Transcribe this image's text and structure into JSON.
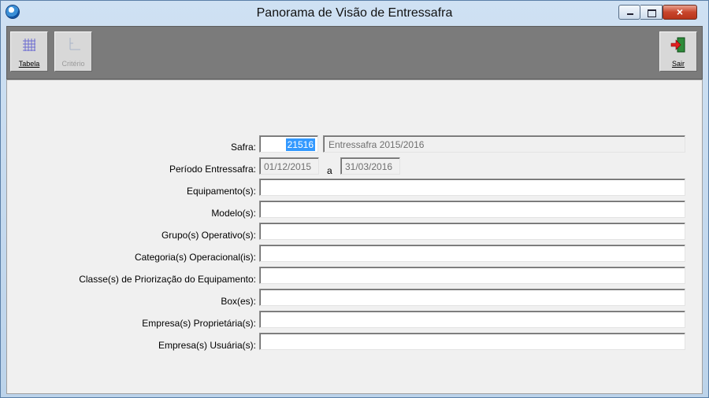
{
  "window": {
    "title": "Panorama de Visão de Entressafra",
    "controls": {
      "minimize": "minimize-icon",
      "maximize": "maximize-icon",
      "close": "×"
    }
  },
  "toolbar": {
    "tabela_label": "Tabela",
    "criterio_label": "Critério",
    "sair_label": "Sair"
  },
  "form": {
    "safra_label": "Safra:",
    "safra_code": "21516",
    "safra_desc": "Entressafra 2015/2016",
    "periodo_label": "Período Entressafra:",
    "periodo_start": "01/12/2015",
    "periodo_sep": "a",
    "periodo_end": "31/03/2016",
    "fields": [
      {
        "label": "Equipamento(s):",
        "value": ""
      },
      {
        "label": "Modelo(s):",
        "value": ""
      },
      {
        "label": "Grupo(s) Operativo(s):",
        "value": ""
      },
      {
        "label": "Categoria(s) Operacional(is):",
        "value": ""
      },
      {
        "label": "Classe(s) de Priorização do Equipamento:",
        "value": ""
      },
      {
        "label": "Box(es):",
        "value": ""
      },
      {
        "label": "Empresa(s) Proprietária(s):",
        "value": ""
      },
      {
        "label": "Empresa(s) Usuária(s):",
        "value": ""
      }
    ]
  }
}
